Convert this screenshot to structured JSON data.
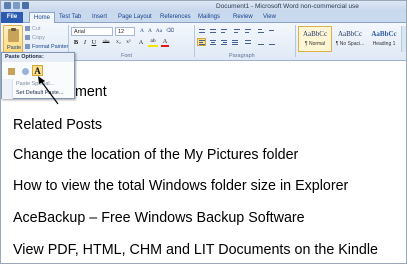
{
  "window": {
    "title": "Document1 - Microsoft Word non-commercial use"
  },
  "ribbon_tabs": [
    {
      "label": "File"
    },
    {
      "label": "Home"
    },
    {
      "label": "Test Tab"
    },
    {
      "label": "Insert"
    },
    {
      "label": "Page Layout"
    },
    {
      "label": "References"
    },
    {
      "label": "Mailings"
    },
    {
      "label": "Review"
    },
    {
      "label": "View"
    }
  ],
  "clipboard": {
    "paste_label": "Paste",
    "cut_label": "Cut",
    "copy_label": "Copy",
    "format_painter_label": "Format Painter"
  },
  "font": {
    "name": "Arial",
    "size": "12",
    "group_label": "Font",
    "bold": "B",
    "italic": "I",
    "underline": "U",
    "strike": "abe",
    "subscript": "x₂",
    "superscript": "x²",
    "grow": "A",
    "shrink": "A",
    "change_case": "Aa",
    "font_color": "A",
    "highlight": "ab"
  },
  "paragraph": {
    "group_label": "Paragraph"
  },
  "styles": [
    {
      "sample": "AaBbCc",
      "name": "¶ Normal",
      "selected": true
    },
    {
      "sample": "AaBbCc",
      "name": "¶ No Spaci...",
      "selected": false
    },
    {
      "sample": "AaBbCc",
      "name": "Heading 1",
      "selected": false
    }
  ],
  "paste_options": {
    "header": "Paste Options:",
    "keep_text_icon_glyph": "A",
    "paste_special": "Paste Special...",
    "set_default": "Set Default Paste..."
  },
  "document": {
    "lines": [
      "ument",
      "Related Posts",
      "Change the location of the My Pictures folder",
      "How to view the total Windows folder size in Explorer",
      "AceBackup – Free Windows Backup Software",
      "View PDF, HTML, CHM and LIT Documents on the Kindle"
    ]
  },
  "colors": {
    "file_tab": "#2a5bb0",
    "highlight_selected": "#ffe08a",
    "font_color_bar": "#e01b1b",
    "highlight_color_bar": "#f4e400"
  }
}
